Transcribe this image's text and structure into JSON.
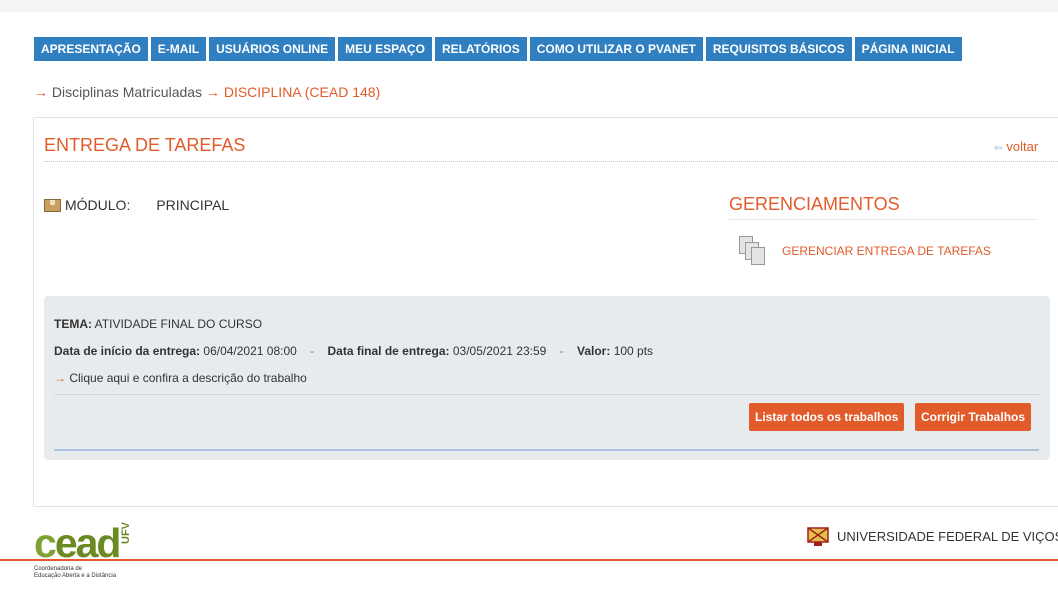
{
  "nav": {
    "items": [
      "APRESENTAÇÃO",
      "E-MAIL",
      "USUÁRIOS ONLINE",
      "MEU ESPAÇO",
      "RELATÓRIOS",
      "COMO UTILIZAR O PVANET",
      "REQUISITOS BÁSICOS",
      "PÁGINA INICIAL"
    ]
  },
  "breadcrumb": {
    "arrow": "→",
    "item1": "Disciplinas Matriculadas",
    "item2": "DISCIPLINA (CEAD 148)"
  },
  "panel": {
    "title": "ENTREGA DE TAREFAS",
    "back_arrow": "⇦",
    "back_label": "voltar",
    "module_label": "MÓDULO:",
    "module_value": "PRINCIPAL",
    "gerenciamentos_title": "GERENCIAMENTOS",
    "gerenciar_label": "GERENCIAR ENTREGA DE TAREFAS"
  },
  "tarefa": {
    "tema_label": "TEMA:",
    "tema_value": "ATIVIDADE FINAL DO CURSO",
    "inicio_label": "Data de início da entrega:",
    "inicio_value": "06/04/2021 08:00",
    "sep": "-",
    "final_label": "Data final de entrega:",
    "final_value": "03/05/2021 23:59",
    "valor_label": "Valor:",
    "valor_value": "100 pts",
    "descricao_arrow": "→",
    "descricao_link": "Clique aqui e confira a descrição do trabalho",
    "btn_listar": "Listar todos os trabalhos",
    "btn_corrigir": "Corrigir Trabalhos"
  },
  "footer": {
    "cead_c": "c",
    "cead_rest": "ead",
    "ufv": "UFV",
    "coord_line1": "Coordenadoria de",
    "coord_line2": "Educação Aberta e a Distância",
    "university": "UNIVERSIDADE FEDERAL DE VIÇOSA"
  },
  "colors": {
    "nav_blue": "#2f7fc1",
    "accent_orange": "#e25b2a",
    "cead_green": "#6c8a24",
    "panel_gray": "#e8ebee"
  }
}
